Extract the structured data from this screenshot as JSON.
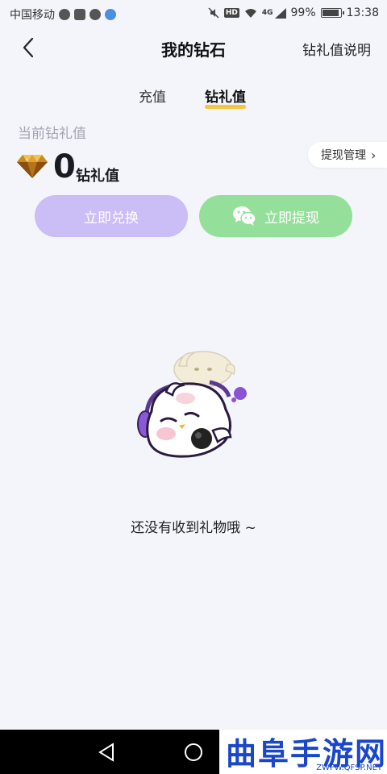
{
  "status_bar": {
    "carrier": "中国移动",
    "icons": [
      "wechat-icon",
      "video-app-icon",
      "message-icon",
      "app-icon"
    ],
    "right_icons": [
      "mute-icon",
      "hd-icon",
      "wifi-icon",
      "signal-icon",
      "battery-icon"
    ],
    "hd": "HD",
    "network": "4G",
    "battery": "99%",
    "battery_level": 0.99,
    "time": "13:38"
  },
  "header": {
    "title": "我的钻石",
    "right_link": "钻礼值说明"
  },
  "tabs": [
    {
      "label": "充值",
      "active": false
    },
    {
      "label": "钻礼值",
      "active": true
    }
  ],
  "balance": {
    "label": "当前钻礼值",
    "value": "0",
    "unit": "钻礼值",
    "manage_button": "提现管理",
    "manage_chevron": "›"
  },
  "actions": {
    "exchange": "立即兑换",
    "withdraw": "立即提现"
  },
  "empty_state": {
    "message": "还没有收到礼物哦 ~"
  },
  "watermark": {
    "text": "曲阜手游网",
    "url": "ZWFW.QFSP.NET"
  },
  "colors": {
    "background": "#f4f5fb",
    "tab_underline": "#f5c543",
    "exchange_button": "#cbbdf5",
    "withdraw_button": "#94e09a",
    "watermark": "#1a47c9"
  }
}
